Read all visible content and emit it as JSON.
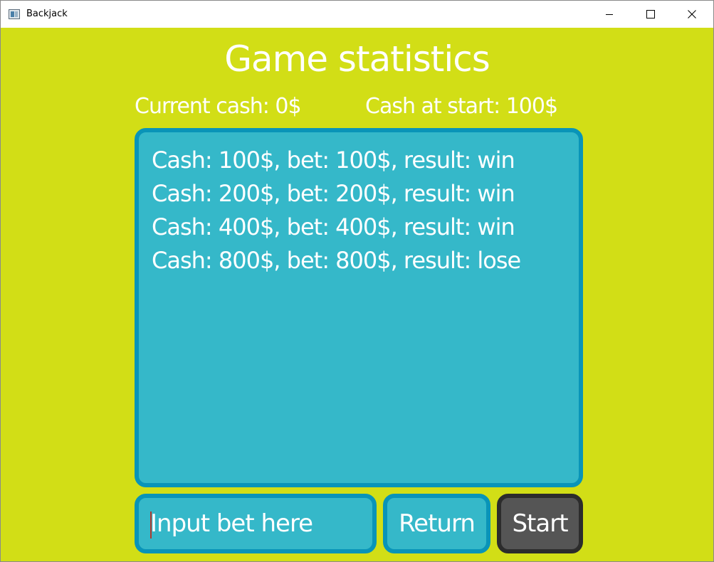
{
  "window": {
    "title": "Backjack",
    "controls": [
      "minimize",
      "maximize",
      "close"
    ]
  },
  "page": {
    "heading": "Game statistics",
    "current_cash": "Current cash: 0$",
    "cash_at_start": "Cash at start: 100$"
  },
  "history": [
    "Cash: 100$, bet: 100$, result: win",
    "Cash: 200$, bet: 200$, result: win",
    "Cash: 400$, bet: 400$, result: win",
    "Cash: 800$, bet: 800$, result: lose"
  ],
  "controls": {
    "bet_placeholder": "Input bet here",
    "return_label": "Return",
    "start_label": "Start"
  },
  "colors": {
    "background": "#d2de16",
    "panel": "#35b8c9",
    "panel_border": "#0994b8",
    "start_button": "#555555",
    "start_border": "#2c2c2c",
    "text": "#ffffff"
  }
}
